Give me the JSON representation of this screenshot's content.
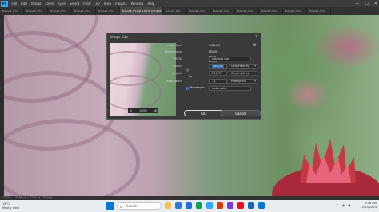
{
  "app": {
    "menu": [
      "File",
      "Edit",
      "Image",
      "Layer",
      "Type",
      "Select",
      "Filter",
      "3D",
      "View",
      "Plugins",
      "Window",
      "Help"
    ],
    "window_controls": [
      "—",
      "☐",
      "✕"
    ]
  },
  "tabs": [
    {
      "label": "KS227.JPG",
      "active": false
    },
    {
      "label": "KS229.JPG",
      "active": false
    },
    {
      "label": "KS230.JPG",
      "active": false
    },
    {
      "label": "KS231.JPG",
      "active": false
    },
    {
      "label": "KS232.JPG",
      "active": false
    },
    {
      "label": "KS234.JPG @ 100% (RGB/8)",
      "active": true
    },
    {
      "label": "KS235.JPG",
      "active": false
    },
    {
      "label": "KS236.JPG",
      "active": false
    },
    {
      "label": "KS237.JPG",
      "active": false
    },
    {
      "label": "KS238.JPG",
      "active": false
    },
    {
      "label": "KS239.JPG",
      "active": false
    },
    {
      "label": "KS240.JPG",
      "active": false
    },
    {
      "label": "KS241.JPG",
      "active": false
    }
  ],
  "status": {
    "zoom": "100%",
    "doc_size": "4246 px x 4246 px (72 ppi)"
  },
  "dialog": {
    "title": "Image Size",
    "image_size_label": "Image Size:",
    "image_size_value": "108.0M",
    "dimensions_label": "Dimensions:",
    "dimensions_value": "6049 px  ×  6249 px",
    "fit_to_label": "Fit To:",
    "fit_to_value": "Original Size",
    "width_label": "Width:",
    "width_value": "216.75",
    "width_unit": "Centimeters",
    "height_label": "Height:",
    "height_value": "216.75",
    "height_unit": "Centimeters",
    "resolution_label": "Resolution:",
    "resolution_value": "72",
    "resolution_unit": "Pixels/Inch",
    "resample_label": "Resample:",
    "resample_value": "Automatic",
    "preview_zoom": "100%",
    "ok_label": "OK",
    "cancel_label": "Cancel"
  },
  "taskbar": {
    "weather_temp": "19°C",
    "weather_desc": "Mostly clear",
    "search_placeholder": "Search",
    "time": "9:56 AM",
    "date": "12/13/2024",
    "app_icon_colors": [
      "#f2c14e",
      "#2b7bd6",
      "#1f6fd6",
      "#0aa34f",
      "#31a8ff",
      "#d83b01",
      "#7a3cd6",
      "#e81123",
      "#1565c0",
      "#0078d4"
    ]
  }
}
